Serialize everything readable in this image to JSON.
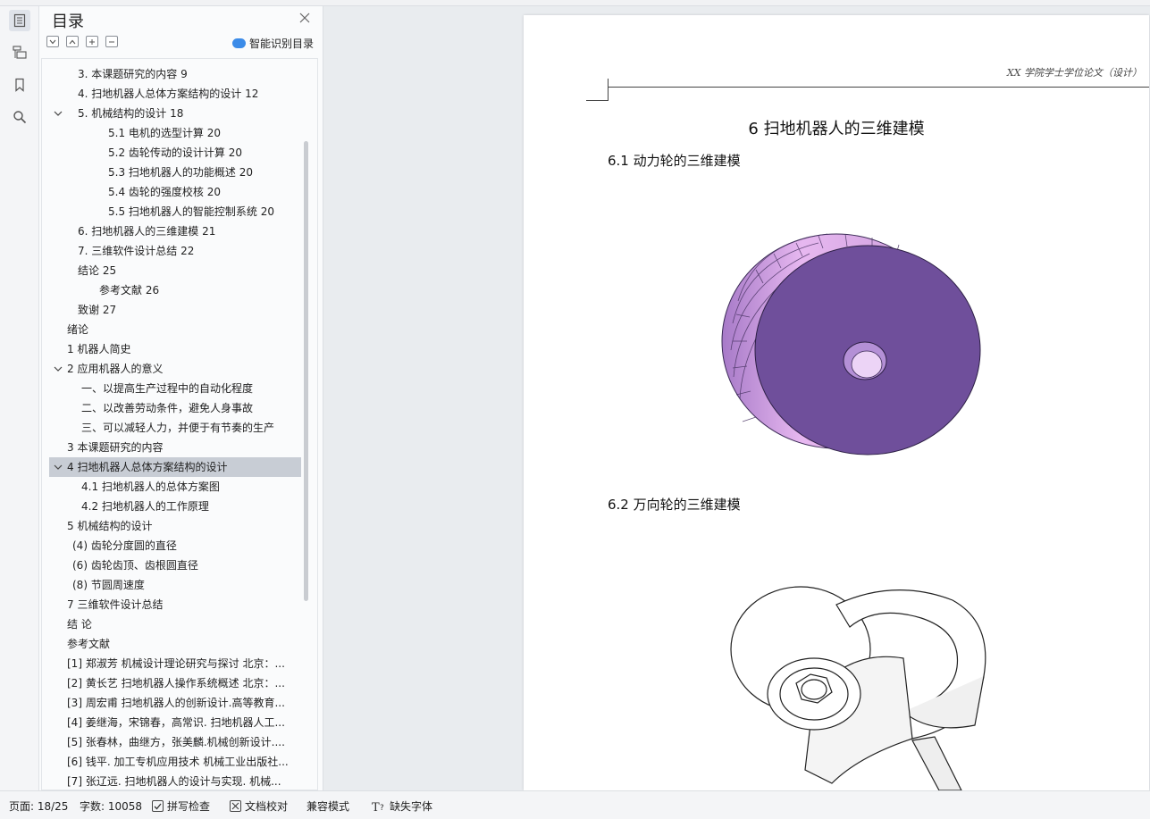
{
  "sidebar": {
    "title": "目录",
    "smart_label": "智能识别目录",
    "items": [
      {
        "label": "3. 本课题研究的内容 9"
      },
      {
        "label": "4. 扫地机器人总体方案结构的设计 12"
      },
      {
        "label": "5. 机械结构的设计 18"
      },
      {
        "label": "5.1 电机的选型计算 20"
      },
      {
        "label": "5.2 齿轮传动的设计计算   20"
      },
      {
        "label": "5.3 扫地机器人的功能概述 20"
      },
      {
        "label": "5.4  齿轮的强度校核 20"
      },
      {
        "label": "5.5  扫地机器人的智能控制系统 20"
      },
      {
        "label": "6. 扫地机器人的三维建模 21"
      },
      {
        "label": "7. 三维软件设计总结 22"
      },
      {
        "label": "结论 25"
      },
      {
        "label": "参考文献 26"
      },
      {
        "label": "致谢 27"
      },
      {
        "label": "绪论"
      },
      {
        "label": "1 机器人简史"
      },
      {
        "label": "2 应用机器人的意义"
      },
      {
        "label": "一、以提高生产过程中的自动化程度"
      },
      {
        "label": "二、以改善劳动条件，避免人身事故"
      },
      {
        "label": "三、可以减轻人力，并便于有节奏的生产"
      },
      {
        "label": "3 本课题研究的内容"
      },
      {
        "label": "4 扫地机器人总体方案结构的设计"
      },
      {
        "label": "4.1  扫地机器人的总体方案图"
      },
      {
        "label": "4.2  扫地机器人的工作原理"
      },
      {
        "label": "5 机械结构的设计"
      },
      {
        "label": "(4)  齿轮分度圆的直径"
      },
      {
        "label": "(6)  齿轮齿顶、齿根圆直径"
      },
      {
        "label": "(8)  节圆周速度"
      },
      {
        "label": "7 三维软件设计总结"
      },
      {
        "label": "结   论"
      },
      {
        "label": "参考文献"
      },
      {
        "label": "[1] 郑淑芳  机械设计理论研究与探讨  北京：..."
      },
      {
        "label": "[2] 黄长艺  扫地机器人操作系统概述  北京：..."
      },
      {
        "label": "[3] 周宏甫  扫地机器人的创新设计.高等教育..."
      },
      {
        "label": "[4] 姜继海，宋锦春，高常识. 扫地机器人工..."
      },
      {
        "label": "[5] 张春林，曲继方，张美麟.机械创新设计...."
      },
      {
        "label": "[6] 钱平. 加工专机应用技术  机械工业出版社..."
      },
      {
        "label": "[7] 张辽远. 扫地机器人的设计与实现. 机械..."
      }
    ]
  },
  "document": {
    "header_text": "XX 学院学士学位论文（设计）",
    "chapter_title": "6  扫地机器人的三维建模",
    "section_1": "6.1  动力轮的三维建模",
    "section_2": "6.2  万向轮的三维建模"
  },
  "status_bar": {
    "page": "页面: 18/25",
    "words": "字数: 10058",
    "spell_check": "拼写检查",
    "doc_check": "文档校对",
    "compat_mode": "兼容模式",
    "missing_font": "缺失字体"
  },
  "colors": {
    "wheel_face": "#6f4f9b",
    "wheel_rim": "#d9a8e8",
    "selected_row": "#c8cdd5"
  }
}
